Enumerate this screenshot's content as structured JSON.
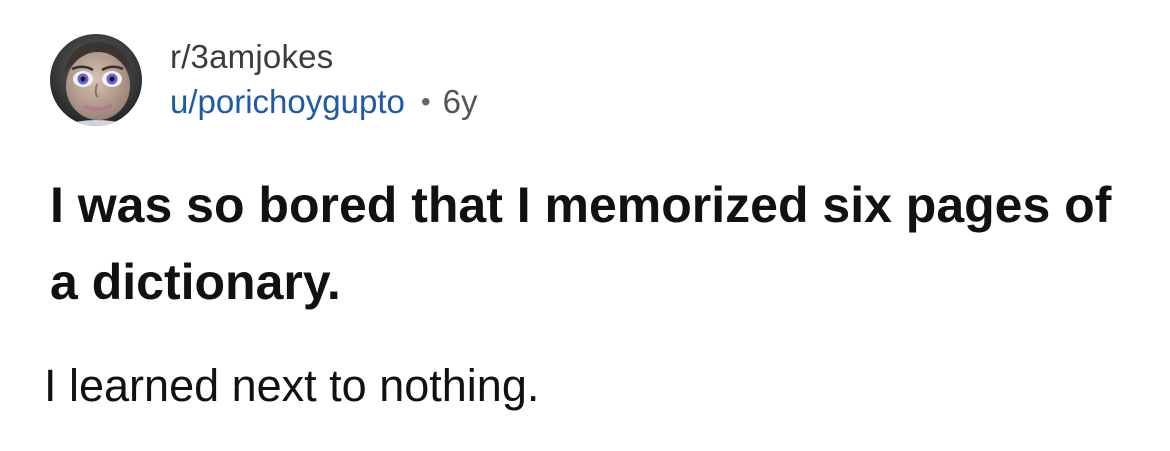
{
  "post": {
    "subreddit": "r/3amjokes",
    "username": "u/porichoygupto",
    "separator": "•",
    "age": "6y",
    "title": "I was so bored that I memorized six pages of a dictionary.",
    "body": "I learned next to nothing.",
    "avatar_icon": "cartoon-face-avatar-icon"
  },
  "colors": {
    "subreddit": "#3c3c3c",
    "username": "#1f5aa6",
    "title": "#111111",
    "background": "#ffffff"
  }
}
